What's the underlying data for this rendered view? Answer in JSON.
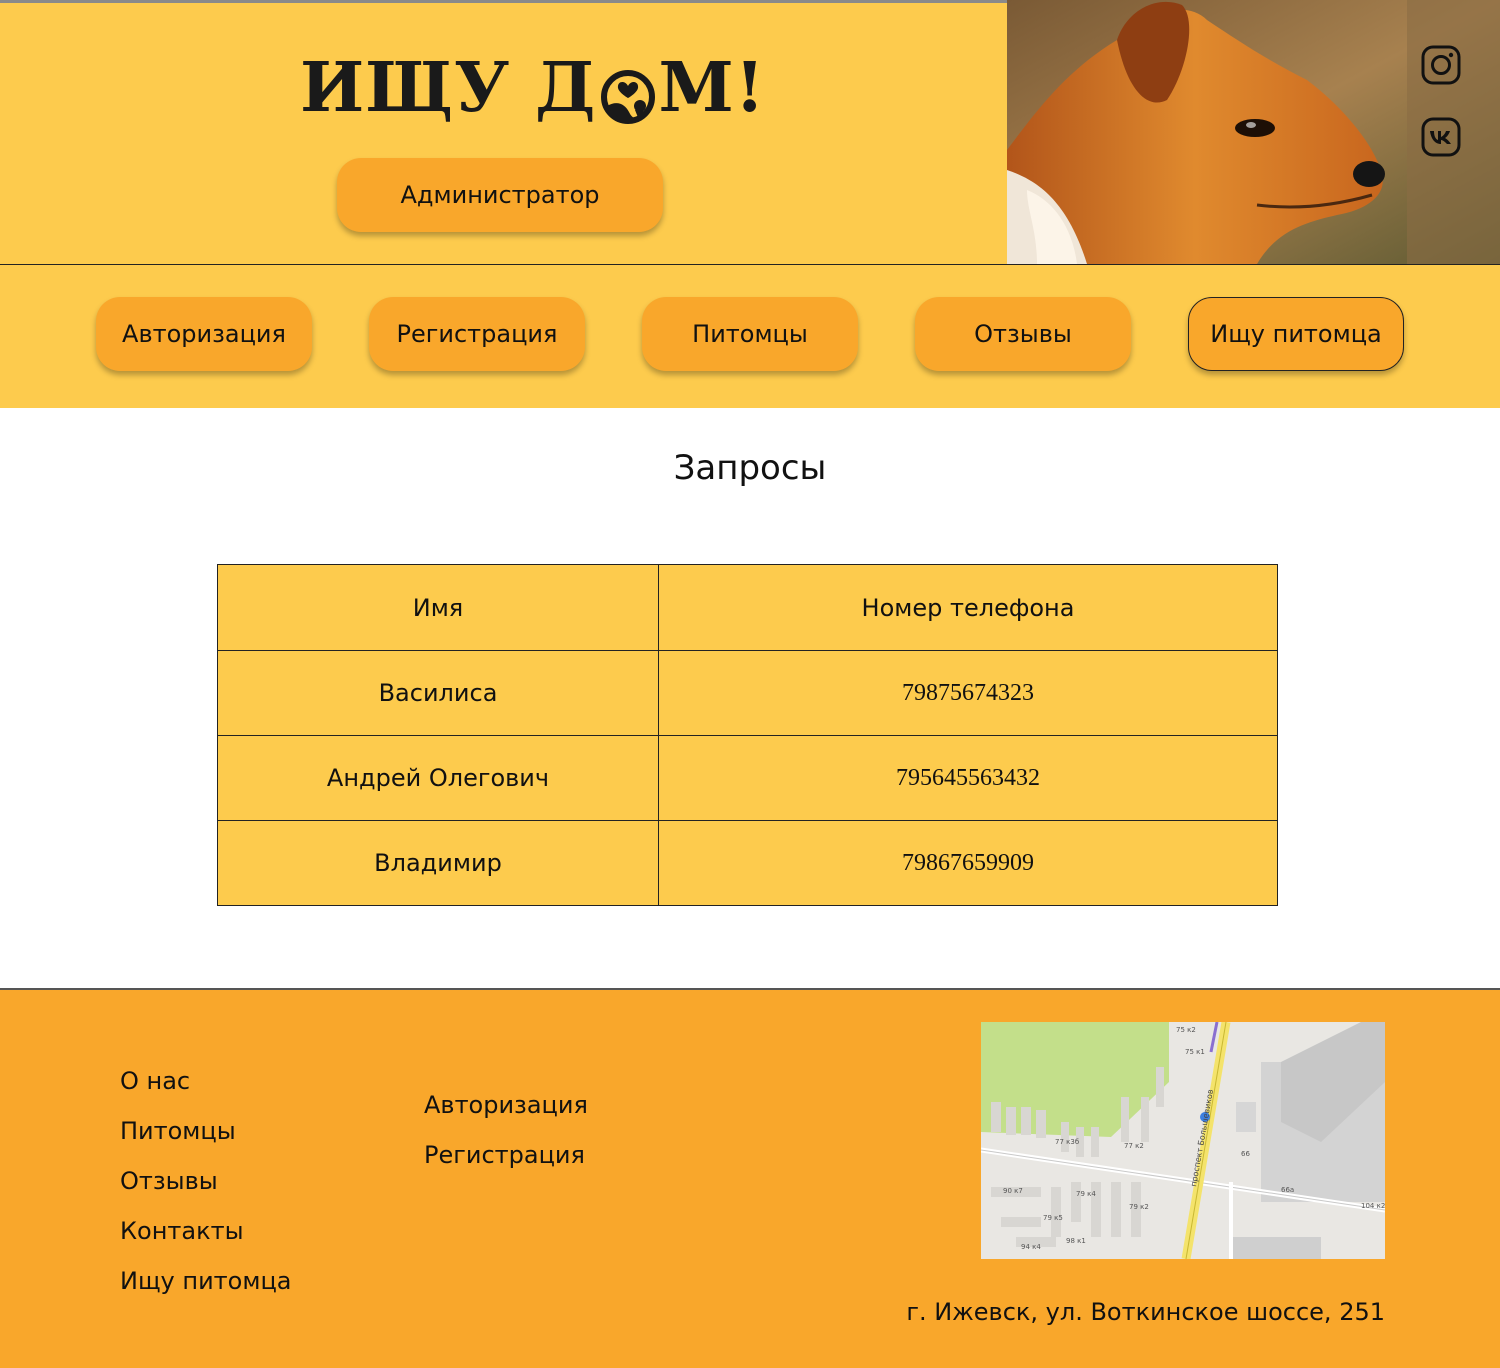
{
  "header": {
    "logo_text_left": "ИЩУ Д",
    "logo_text_right": "М!",
    "admin_button": "Администратор"
  },
  "social": {
    "instagram": "instagram-icon",
    "vk": "vk-icon"
  },
  "nav": {
    "items": [
      {
        "label": "Авторизация"
      },
      {
        "label": "Регистрация"
      },
      {
        "label": "Питомцы"
      },
      {
        "label": "Отзывы"
      },
      {
        "label": "Ищу питомца",
        "active": true
      }
    ]
  },
  "main": {
    "title": "Запросы",
    "table": {
      "headers": [
        "Имя",
        "Номер телефона"
      ],
      "rows": [
        [
          "Василиса",
          "79875674323"
        ],
        [
          "Андрей Олегович",
          "795645563432"
        ],
        [
          "Владимир",
          "79867659909"
        ]
      ]
    }
  },
  "footer": {
    "col1": [
      "О нас",
      "Питомцы",
      "Отзывы",
      "Контакты",
      "Ищу питомца"
    ],
    "col2": [
      "Авторизация",
      "Регистрация"
    ],
    "map_labels": [
      "75 к2",
      "75 к1",
      "77 к3б",
      "77 к2",
      "66",
      "90 к7",
      "79 к4",
      "79 к2",
      "66а",
      "104 к2",
      "79 к5",
      "98 к1",
      "94 к4",
      "проспект Большевиков"
    ],
    "address": "г. Ижевск, ул. Воткинское шоссе, 251"
  },
  "colors": {
    "header_bg": "#fdcb4d",
    "button_bg": "#f9a72b",
    "footer_bg": "#f9a72b",
    "text": "#111111"
  }
}
